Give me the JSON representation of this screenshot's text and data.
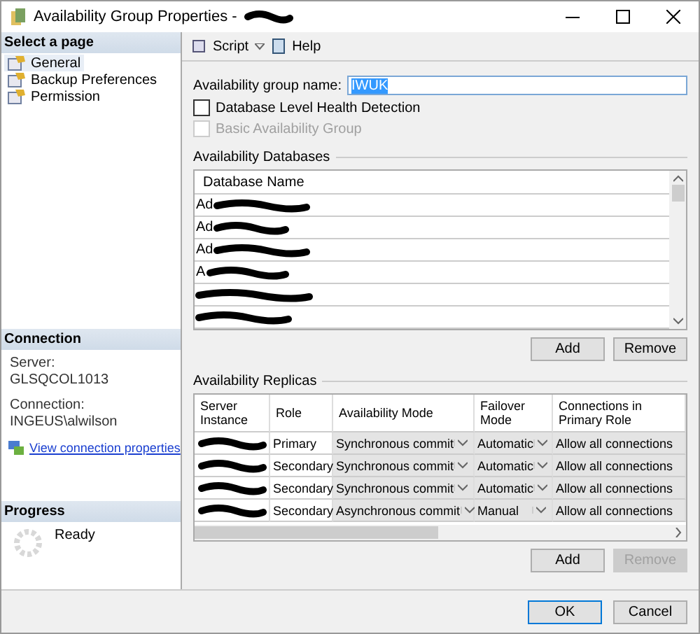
{
  "window": {
    "title": "Availability Group Properties -",
    "title_redacted": true
  },
  "sidebar": {
    "header": "Select a page",
    "items": [
      {
        "label": "General",
        "selected": true
      },
      {
        "label": "Backup Preferences",
        "selected": false
      },
      {
        "label": "Permission",
        "selected": false
      }
    ]
  },
  "connection": {
    "header": "Connection",
    "server_label": "Server:",
    "server": "GLSQCOL1013",
    "connection_label": "Connection:",
    "user": "INGEUS\\alwilson",
    "link": "View connection properties"
  },
  "progress": {
    "header": "Progress",
    "status": "Ready"
  },
  "toolbar": {
    "script": "Script",
    "help": "Help"
  },
  "form": {
    "name_label": "Availability group name:",
    "name_value": "IWUK",
    "checkboxes": [
      {
        "label": "Database Level Health Detection",
        "checked": false,
        "disabled": false
      },
      {
        "label": "Basic Availability Group",
        "checked": false,
        "disabled": true
      }
    ]
  },
  "databases": {
    "title": "Availability Databases",
    "column": "Database Name",
    "rows": [
      {
        "name": "Ad",
        "redacted": true
      },
      {
        "name": "Ad",
        "redacted": true
      },
      {
        "name": "Ad",
        "redacted": true
      },
      {
        "name": "A",
        "redacted": true
      },
      {
        "redacted": true
      },
      {
        "redacted": true
      }
    ],
    "buttons": [
      {
        "label": "Add",
        "disabled": false
      },
      {
        "label": "Remove",
        "disabled": false
      }
    ]
  },
  "replicas": {
    "title": "Availability Replicas",
    "columns": [
      "Server Instance",
      "Role",
      "Availability Mode",
      "Failover Mode",
      "Connections in Primary Role"
    ],
    "rows": [
      {
        "server_instance_redacted": true,
        "role": "Primary",
        "availability_mode": "Synchronous commit",
        "failover_mode": "Automatic",
        "connections": "Allow all connections"
      },
      {
        "server_instance_redacted": true,
        "role": "Secondary",
        "availability_mode": "Synchronous commit",
        "failover_mode": "Automatic",
        "connections": "Allow all connections"
      },
      {
        "server_instance_redacted": true,
        "role": "Secondary",
        "availability_mode": "Synchronous commit",
        "failover_mode": "Automatic",
        "connections": "Allow all connections"
      },
      {
        "server_instance_redacted": true,
        "role": "Secondary",
        "availability_mode": "Asynchronous commit",
        "failover_mode": "Manual",
        "connections": "Allow all connections"
      }
    ],
    "buttons": [
      {
        "label": "Add",
        "disabled": false
      },
      {
        "label": "Remove",
        "disabled": true
      }
    ]
  },
  "dialog_buttons": [
    {
      "label": "OK",
      "default": true
    },
    {
      "label": "Cancel",
      "default": false
    }
  ]
}
